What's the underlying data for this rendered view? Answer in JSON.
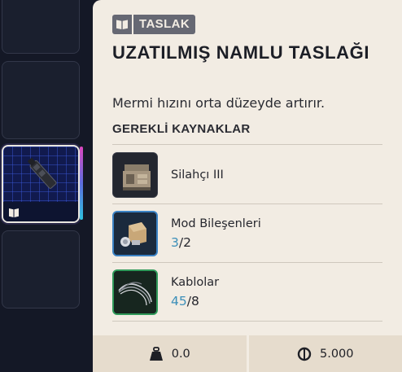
{
  "inventory": {
    "selected_item_icon": "weapon-barrel-blueprint-icon",
    "selected_item_badge_icon": "book-icon"
  },
  "tooltip": {
    "badge_icon": "book-icon",
    "badge_label": "TASLAK",
    "title": "UZATILMIŞ NAMLU TASLAĞI",
    "description": "Mermi hızını orta düzeyde artırır.",
    "requirements_heading": "GEREKLİ KAYNAKLAR",
    "resources": [
      {
        "name": "Silahçı III",
        "icon": "gunsmith-bench-icon",
        "have": "",
        "need": ""
      },
      {
        "name": "Mod Bileşenleri",
        "icon": "mod-components-icon",
        "have": "3",
        "need": "2"
      },
      {
        "name": "Kablolar",
        "icon": "wires-icon",
        "have": "45",
        "need": "8"
      }
    ],
    "footer": {
      "weight_icon": "weight-icon",
      "weight": "0.0",
      "price_icon": "coin-icon",
      "price": "5.000"
    }
  },
  "colors": {
    "panel_bg": "#f2ece3",
    "footer_bg": "#e6dccd",
    "badge_bg": "#666873",
    "have_qty": "#3c8fb9",
    "rarity_blue": "#3b82c4",
    "rarity_green": "#2f9a5a"
  }
}
